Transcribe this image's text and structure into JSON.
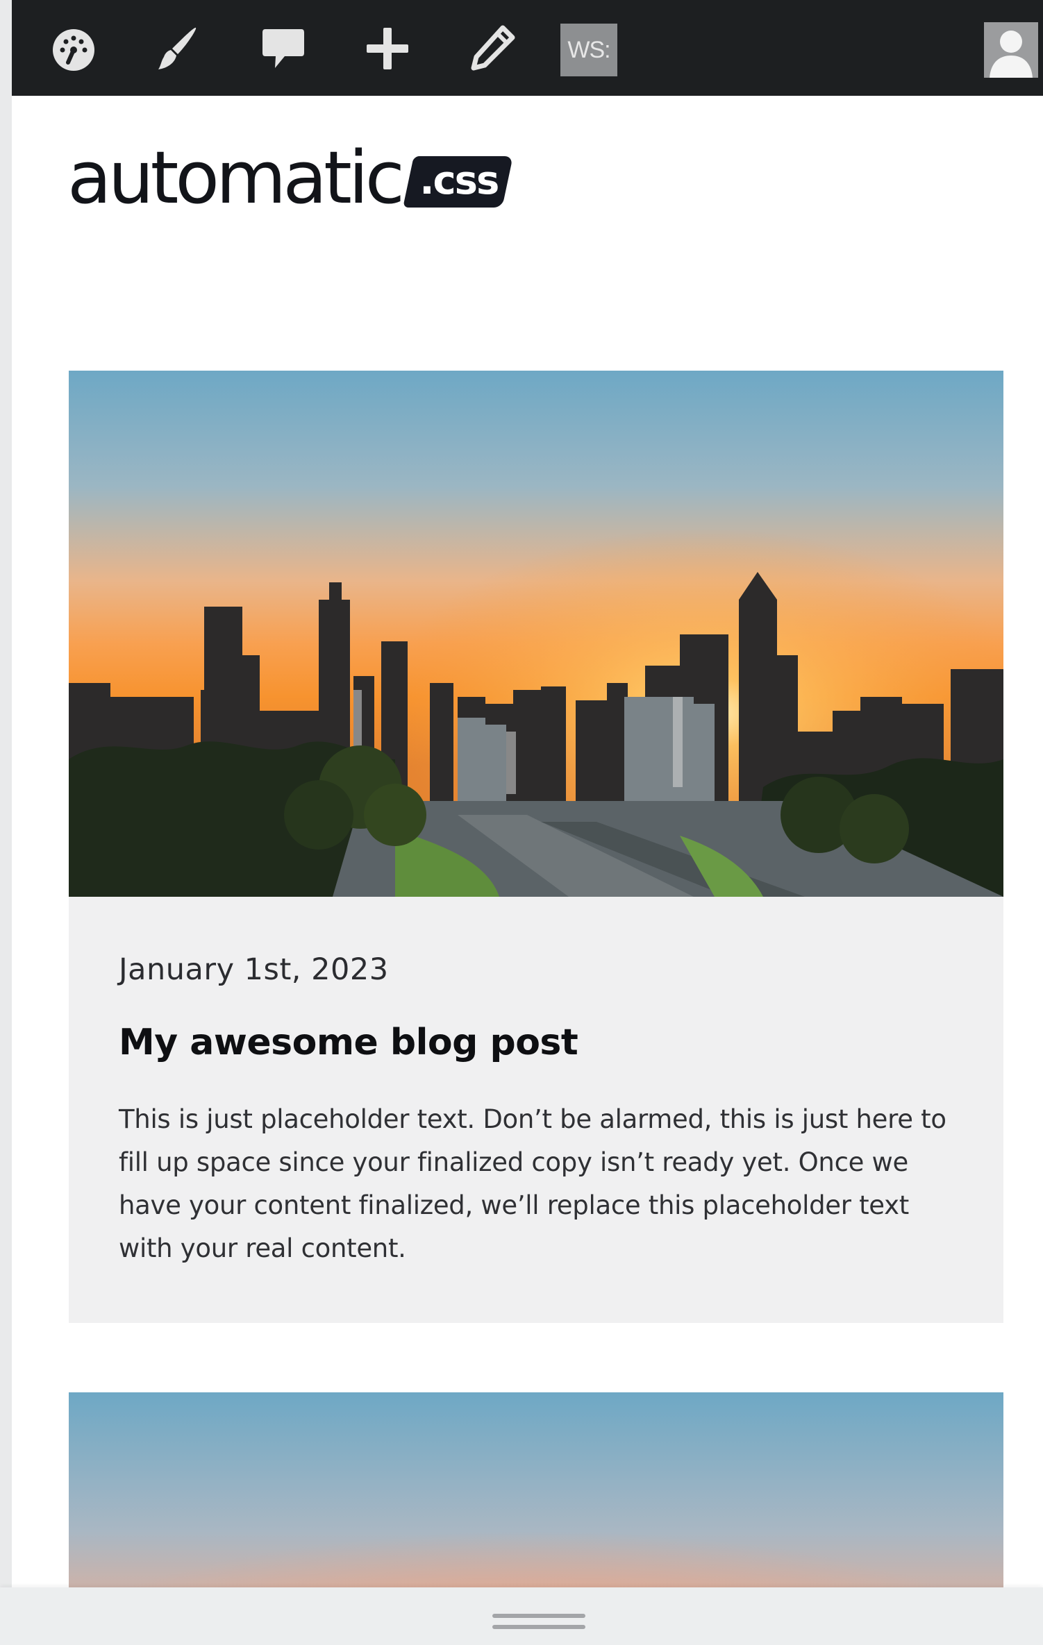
{
  "admin_bar": {
    "tools": [
      {
        "icon": "dashboard-icon"
      },
      {
        "icon": "brush-icon"
      },
      {
        "icon": "comment-icon"
      },
      {
        "icon": "add-new-icon"
      },
      {
        "icon": "edit-icon"
      }
    ],
    "ws_label": "WS:",
    "avatar_icon": "user-avatar-icon"
  },
  "logo": {
    "word": "automatic",
    "badge": ".css"
  },
  "posts": [
    {
      "date": "January 1st, 2023",
      "title": "My awesome blog post",
      "excerpt": "This is just placeholder text. Don’t be alarmed, this is just here to fill up space since your finalized copy isn’t ready yet. Once we have your content finalized, we’ll replace this placeholder text with your real content."
    }
  ],
  "colors": {
    "admin_bar_bg": "#1d1f21",
    "card_body_bg": "#f0f0f1",
    "logo_text": "#121419",
    "sky_top": "#6fa7c4",
    "sky_sunset": "#f7a35a"
  }
}
